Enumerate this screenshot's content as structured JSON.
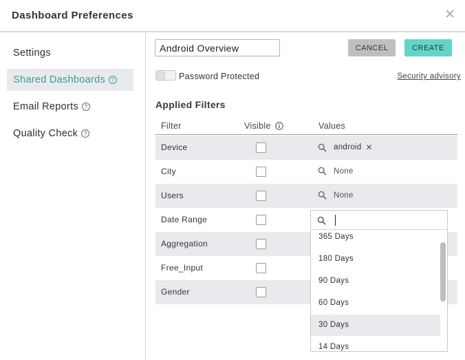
{
  "dialog": {
    "title": "Dashboard Preferences"
  },
  "sidebar": {
    "items": [
      {
        "label": "Settings",
        "help": false,
        "active": false
      },
      {
        "label": "Shared Dashboards",
        "help": true,
        "active": true
      },
      {
        "label": "Email Reports",
        "help": true,
        "active": false
      },
      {
        "label": "Quality Check",
        "help": true,
        "active": false
      }
    ],
    "help_glyph": "?"
  },
  "form": {
    "name_value": "Android Overview",
    "cancel_label": "CANCEL",
    "create_label": "CREATE",
    "password_label": "Password Protected",
    "password_enabled": false,
    "advisory_label": "Security advisory"
  },
  "filters": {
    "section_title": "Applied Filters",
    "headers": {
      "filter": "Filter",
      "visible": "Visible",
      "values": "Values"
    },
    "rows": [
      {
        "name": "Device",
        "visible": false,
        "value": "android",
        "removable": true
      },
      {
        "name": "City",
        "visible": false,
        "value": "None",
        "removable": false
      },
      {
        "name": "Users",
        "visible": false,
        "value": "None",
        "removable": false
      },
      {
        "name": "Date Range",
        "visible": false,
        "value": "",
        "removable": false
      },
      {
        "name": "Aggregation",
        "visible": false,
        "value": "",
        "removable": false
      },
      {
        "name": "Free_Input",
        "visible": false,
        "value": "",
        "removable": false
      },
      {
        "name": "Gender",
        "visible": false,
        "value": "",
        "removable": false
      }
    ]
  },
  "dropdown": {
    "search_value": "",
    "options": [
      "365 Days",
      "180 Days",
      "90 Days",
      "60 Days",
      "30 Days",
      "14 Days"
    ],
    "highlighted": "30 Days"
  },
  "colors": {
    "accent": "#3f9a8c",
    "create_button": "#63d5c6",
    "row_shade": "#e9eaee"
  },
  "icons": {
    "close": "close-icon",
    "search": "search-icon",
    "info": "info-icon"
  }
}
